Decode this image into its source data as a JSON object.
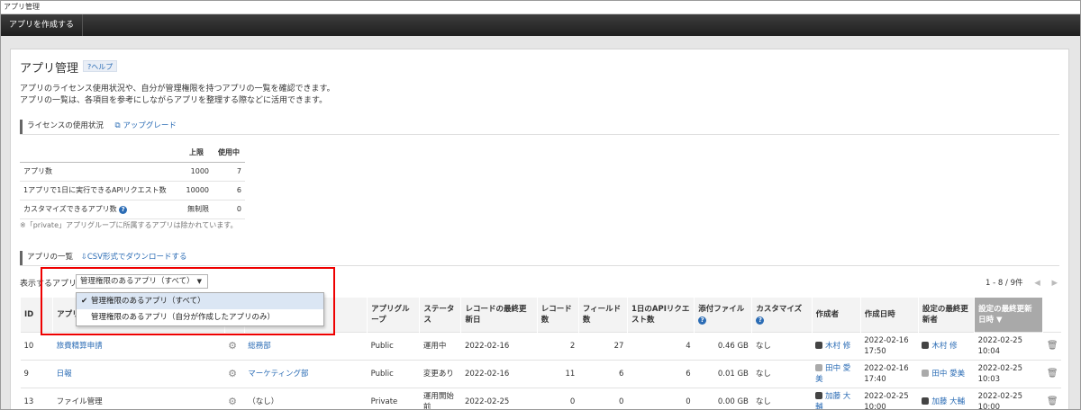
{
  "window": {
    "title": "アプリ管理"
  },
  "toolbar": {
    "create_app": "アプリを作成する"
  },
  "page": {
    "title": "アプリ管理",
    "help": "?ヘルプ",
    "desc1": "アプリのライセンス使用状況や、自分が管理権限を持つアプリの一覧を確認できます。",
    "desc2": "アプリの一覧は、各項目を参考にしながらアプリを整理する際などに活用できます。"
  },
  "license": {
    "section": "ライセンスの使用状況",
    "upgrade": "アップグレード",
    "headers": [
      "上限",
      "使用中"
    ],
    "rows": [
      {
        "label": "アプリ数",
        "limit": "1000",
        "used": "7"
      },
      {
        "label": "1アプリで1日に実行できるAPIリクエスト数",
        "limit": "10000",
        "used": "6"
      },
      {
        "label": "カスタマイズできるアプリ数",
        "limit": "無制限",
        "used": "0"
      }
    ],
    "note": "※「private」アプリグループに所属するアプリは除かれています。"
  },
  "apps": {
    "section": "アプリの一覧",
    "csv": "CSV形式でダウンロードする",
    "display_label": "表示するアプリ",
    "select_value": "管理権限のあるアプリ（すべて）",
    "options": [
      "管理権限のあるアプリ（すべて）",
      "管理権限のあるアプリ（自分が作成したアプリのみ）"
    ],
    "pager": "1 - 8 / 9件",
    "headers": {
      "id": "ID",
      "name": "アプリ",
      "group": "アプリグループ",
      "status": "ステータス",
      "record_updated": "レコードの最終更新日",
      "records": "レコード数",
      "fields": "フィールド数",
      "api": "1日のAPIリクエスト数",
      "files": "添付ファイル",
      "custom": "カスタマイズ",
      "creator": "作成者",
      "created": "作成日時",
      "setting_updater": "設定の最終更新者",
      "setting_updated": "設定の最終更新日時 ▼"
    },
    "rows": [
      {
        "id": "10",
        "name": "旅費精算申請",
        "space": "総務部",
        "group": "Public",
        "status": "運用中",
        "rdate": "2022-02-16",
        "records": "2",
        "fields": "27",
        "api": "4",
        "files": "0.46 GB",
        "custom": "なし",
        "creator": "木村 修",
        "created": "2022-02-16 17:50",
        "updater": "木村 修",
        "updated": "2022-02-25 10:04"
      },
      {
        "id": "9",
        "name": "日報",
        "space": "マーケティング部",
        "group": "Public",
        "status": "変更あり",
        "rdate": "2022-02-16",
        "records": "11",
        "fields": "6",
        "api": "6",
        "files": "0.01 GB",
        "custom": "なし",
        "creator": "田中 愛美",
        "created": "2022-02-16 17:40",
        "updater": "田中 愛美",
        "updated": "2022-02-25 10:03"
      },
      {
        "id": "13",
        "name": "ファイル管理",
        "space": "（なし）",
        "group": "Private",
        "status": "運用開始前",
        "rdate": "2022-02-25",
        "records": "0",
        "fields": "0",
        "api": "0",
        "files": "0.00 GB",
        "custom": "なし",
        "creator": "加藤 大輔",
        "created": "2022-02-25 10:00",
        "updater": "加藤 大輔",
        "updated": "2022-02-25 10:00"
      }
    ]
  }
}
